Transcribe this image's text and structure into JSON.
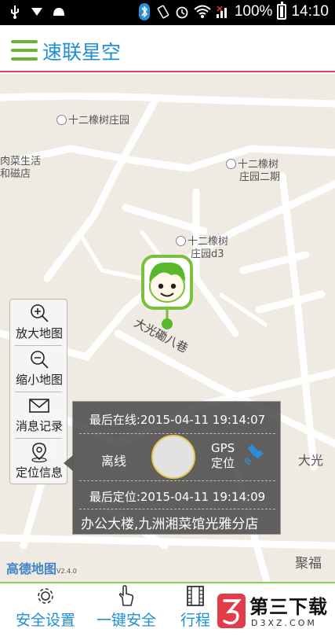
{
  "status_bar": {
    "battery": "100%",
    "time": "14:10"
  },
  "app": {
    "title": "速联星空"
  },
  "map": {
    "labels": [
      "十二橡树庄园",
      "十二橡树",
      "庄园二期",
      "十二橡树",
      "庄园d3",
      "肉菜生活",
      "和磁店",
      "大光"
    ],
    "road_label": "大光磡八巷",
    "road_label_2": "大光磡",
    "bottom_label": "聚福",
    "logo": "高德地图",
    "version": "V2.4.0"
  },
  "tools": [
    {
      "label": "放大地图",
      "icon": "zoom-in-icon"
    },
    {
      "label": "缩小地图",
      "icon": "zoom-out-icon"
    },
    {
      "label": "消息记录",
      "icon": "envelope-icon"
    },
    {
      "label": "定位信息",
      "icon": "location-pin-icon"
    }
  ],
  "info": {
    "last_online": "最后在线:2015-04-11 19:14:07",
    "status": "离线",
    "gps_line1": "GPS",
    "gps_line2": "定位",
    "last_located": "最后定位:2015-04-11 19:14:09",
    "address": "办公大楼,九洲湘菜馆光雅分店"
  },
  "nav": [
    {
      "label": "安全设置",
      "icon": "gear-icon"
    },
    {
      "label": "一键安全",
      "icon": "hand-pointer-icon"
    },
    {
      "label": "行程",
      "icon": "film-icon"
    }
  ],
  "watermark": {
    "main": "第三下载",
    "sub": "D3XZ.COM"
  },
  "colors": {
    "accent": "#1e8ed6",
    "green": "#6ab33a",
    "title_border": "#e2426a"
  }
}
